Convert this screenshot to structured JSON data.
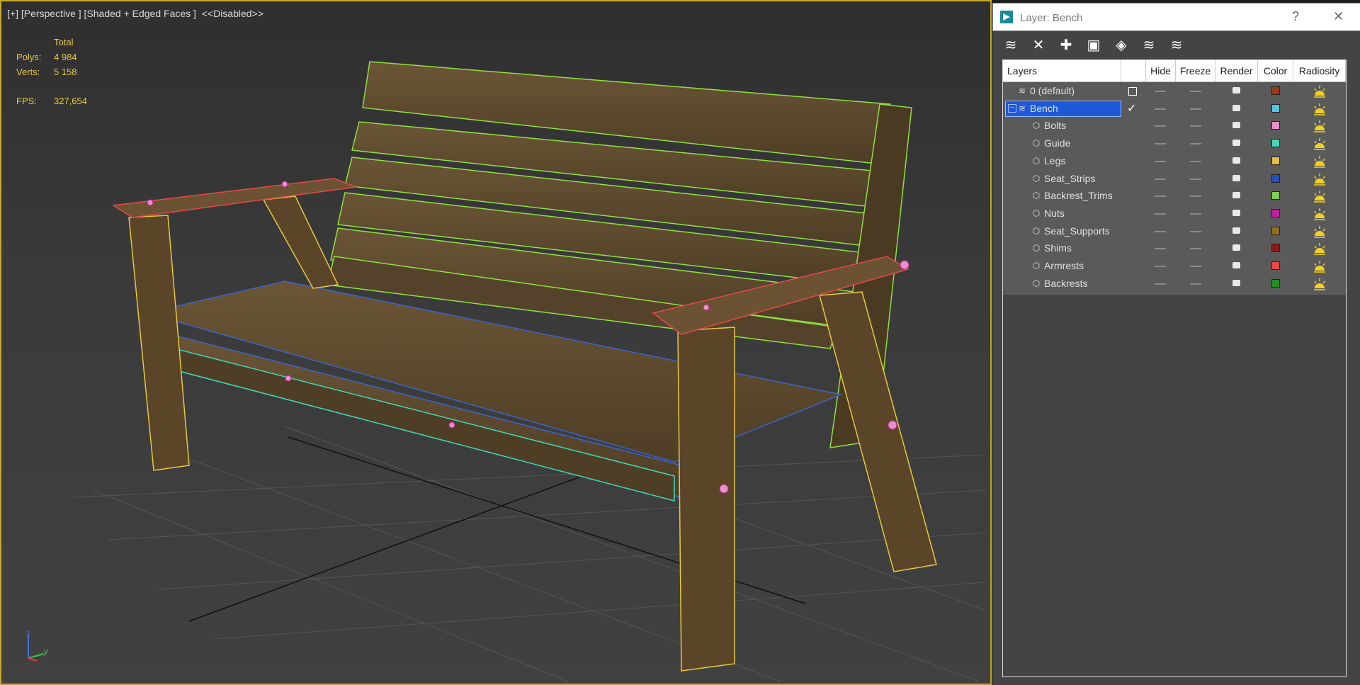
{
  "viewport": {
    "label": "[+] [Perspective ] [Shaded + Edged Faces ]  <<Disabled>>",
    "stats": {
      "total_label": "Total",
      "polys_label": "Polys:",
      "polys_value": "4 984",
      "verts_label": "Verts:",
      "verts_value": "5 158",
      "fps_label": "FPS:",
      "fps_value": "327,654"
    },
    "axis": {
      "z": "z",
      "y": "y"
    }
  },
  "dialog": {
    "title": "Layer: Bench",
    "help_label": "?",
    "close_label": "✕",
    "toolbar": [
      {
        "name": "create-new-layer-icon",
        "glyph": "≋"
      },
      {
        "name": "delete-layer-icon",
        "glyph": "✕"
      },
      {
        "name": "add-to-layer-icon",
        "glyph": "✚"
      },
      {
        "name": "select-objects-icon",
        "glyph": "▣"
      },
      {
        "name": "highlight-layer-icon",
        "glyph": "◈"
      },
      {
        "name": "hide-all-layers-icon",
        "glyph": "≋"
      },
      {
        "name": "freeze-all-layers-icon",
        "glyph": "≋"
      }
    ],
    "columns": {
      "layers": "Layers",
      "hide": "Hide",
      "freeze": "Freeze",
      "render": "Render",
      "color": "Color",
      "radiosity": "Radiosity"
    },
    "layers": [
      {
        "name": "0 (default)",
        "color": "#9a3a10",
        "level": 0,
        "type": "layer",
        "state": "box",
        "selected": false
      },
      {
        "name": "Bench",
        "color": "#4fc8e8",
        "level": 0,
        "type": "layer",
        "state": "check",
        "selected": true
      },
      {
        "name": "Bolts",
        "color": "#e890c8",
        "level": 1,
        "type": "object",
        "state": "",
        "selected": false
      },
      {
        "name": "Guide",
        "color": "#40d8b8",
        "level": 1,
        "type": "object",
        "state": "",
        "selected": false
      },
      {
        "name": "Legs",
        "color": "#e8c040",
        "level": 1,
        "type": "object",
        "state": "",
        "selected": false
      },
      {
        "name": "Seat_Strips",
        "color": "#2050c0",
        "level": 1,
        "type": "object",
        "state": "",
        "selected": false
      },
      {
        "name": "Backrest_Trims",
        "color": "#80d050",
        "level": 1,
        "type": "object",
        "state": "",
        "selected": false
      },
      {
        "name": "Nuts",
        "color": "#c020a0",
        "level": 1,
        "type": "object",
        "state": "",
        "selected": false
      },
      {
        "name": "Seat_Supports",
        "color": "#907018",
        "level": 1,
        "type": "object",
        "state": "",
        "selected": false
      },
      {
        "name": "Shims",
        "color": "#901818",
        "level": 1,
        "type": "object",
        "state": "",
        "selected": false
      },
      {
        "name": "Armrests",
        "color": "#e84848",
        "level": 1,
        "type": "object",
        "state": "",
        "selected": false
      },
      {
        "name": "Backrests",
        "color": "#209020",
        "level": 1,
        "type": "object",
        "state": "",
        "selected": false
      }
    ]
  }
}
